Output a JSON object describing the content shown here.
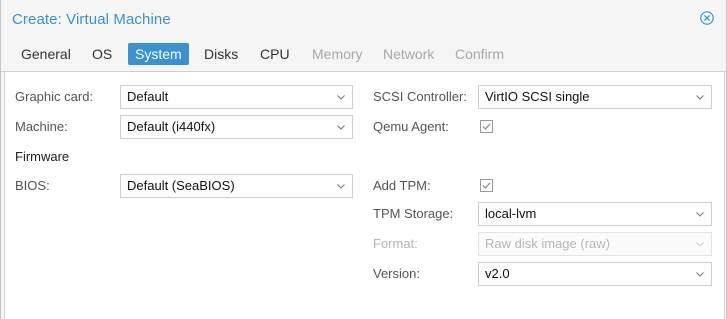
{
  "window": {
    "title": "Create: Virtual Machine",
    "accent": "#3892d4"
  },
  "tabs": [
    {
      "label": "General",
      "state": "normal"
    },
    {
      "label": "OS",
      "state": "normal"
    },
    {
      "label": "System",
      "state": "active"
    },
    {
      "label": "Disks",
      "state": "normal"
    },
    {
      "label": "CPU",
      "state": "normal"
    },
    {
      "label": "Memory",
      "state": "disabled"
    },
    {
      "label": "Network",
      "state": "disabled"
    },
    {
      "label": "Confirm",
      "state": "disabled"
    }
  ],
  "left": {
    "graphic_card": {
      "label": "Graphic card:",
      "value": "Default"
    },
    "machine": {
      "label": "Machine:",
      "value": "Default (i440fx)"
    },
    "firmware_heading": "Firmware",
    "bios": {
      "label": "BIOS:",
      "value": "Default (SeaBIOS)"
    }
  },
  "right": {
    "scsi_controller": {
      "label": "SCSI Controller:",
      "value": "VirtIO SCSI single"
    },
    "qemu_agent": {
      "label": "Qemu Agent:",
      "checked": true
    },
    "add_tpm": {
      "label": "Add TPM:",
      "checked": true
    },
    "tpm_storage": {
      "label": "TPM Storage:",
      "value": "local-lvm"
    },
    "format": {
      "label": "Format:",
      "value": "Raw disk image (raw)",
      "disabled": true
    },
    "version": {
      "label": "Version:",
      "value": "v2.0"
    }
  }
}
